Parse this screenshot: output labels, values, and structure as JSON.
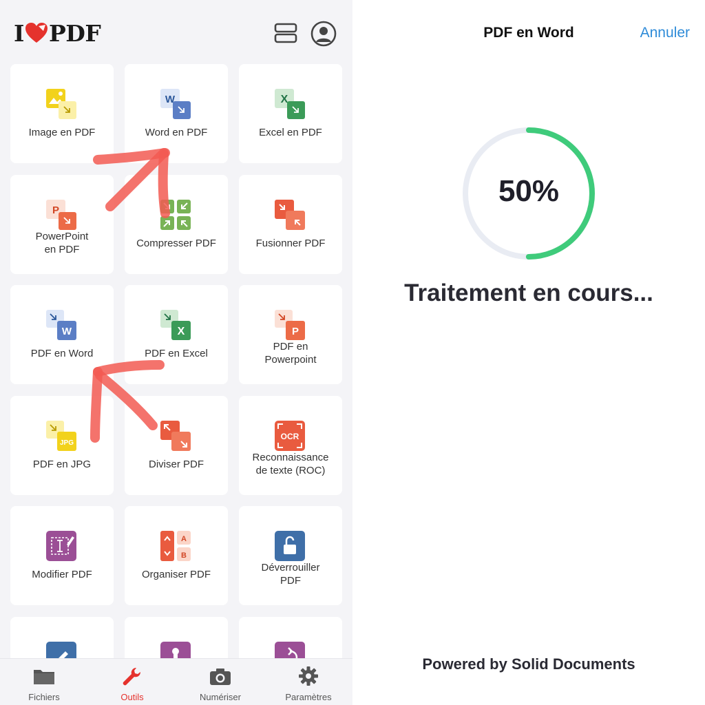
{
  "header": {
    "logo_left": "I",
    "logo_right": "PDF",
    "brand_color": "#e5322d"
  },
  "tools": [
    {
      "label": "Image en PDF",
      "icon": "image-to-pdf-icon"
    },
    {
      "label": "Word en PDF",
      "icon": "word-to-pdf-icon"
    },
    {
      "label": "Excel en PDF",
      "icon": "excel-to-pdf-icon"
    },
    {
      "label": "PowerPoint\nen PDF",
      "icon": "powerpoint-to-pdf-icon"
    },
    {
      "label": "Compresser PDF",
      "icon": "compress-icon"
    },
    {
      "label": "Fusionner PDF",
      "icon": "merge-icon"
    },
    {
      "label": "PDF en Word",
      "icon": "pdf-to-word-icon"
    },
    {
      "label": "PDF en Excel",
      "icon": "pdf-to-excel-icon"
    },
    {
      "label": "PDF en\nPowerpoint",
      "icon": "pdf-to-powerpoint-icon"
    },
    {
      "label": "PDF en JPG",
      "icon": "pdf-to-jpg-icon"
    },
    {
      "label": "Diviser PDF",
      "icon": "split-icon"
    },
    {
      "label": "Reconnaissance\nde texte (ROC)",
      "icon": "ocr-icon",
      "icon_text": "OCR"
    },
    {
      "label": "Modifier PDF",
      "icon": "edit-icon"
    },
    {
      "label": "Organiser PDF",
      "icon": "organize-icon"
    },
    {
      "label": "Déverrouiller\nPDF",
      "icon": "unlock-icon"
    },
    {
      "label": "",
      "icon": "sign-icon"
    },
    {
      "label": "",
      "icon": "stamp-icon"
    },
    {
      "label": "",
      "icon": "rotate-icon"
    }
  ],
  "icon_letters": {
    "word": "W",
    "excel": "X",
    "ppt": "P",
    "jpg": "JPG",
    "a": "A",
    "b": "B"
  },
  "tabs": [
    {
      "label": "Fichiers",
      "icon": "folder-icon",
      "active": false
    },
    {
      "label": "Outils",
      "icon": "wrench-icon",
      "active": true
    },
    {
      "label": "Numériser",
      "icon": "camera-icon",
      "active": false
    },
    {
      "label": "Paramètres",
      "icon": "gear-icon",
      "active": false
    }
  ],
  "conversion": {
    "title": "PDF en Word",
    "cancel_label": "Annuler",
    "progress": 0.5,
    "progress_label": "50%",
    "status": "Traitement en cours...",
    "powered_by": "Powered by Solid Documents",
    "ring_color": "#3fcb7b",
    "ring_track_color": "#e9ecf3"
  }
}
